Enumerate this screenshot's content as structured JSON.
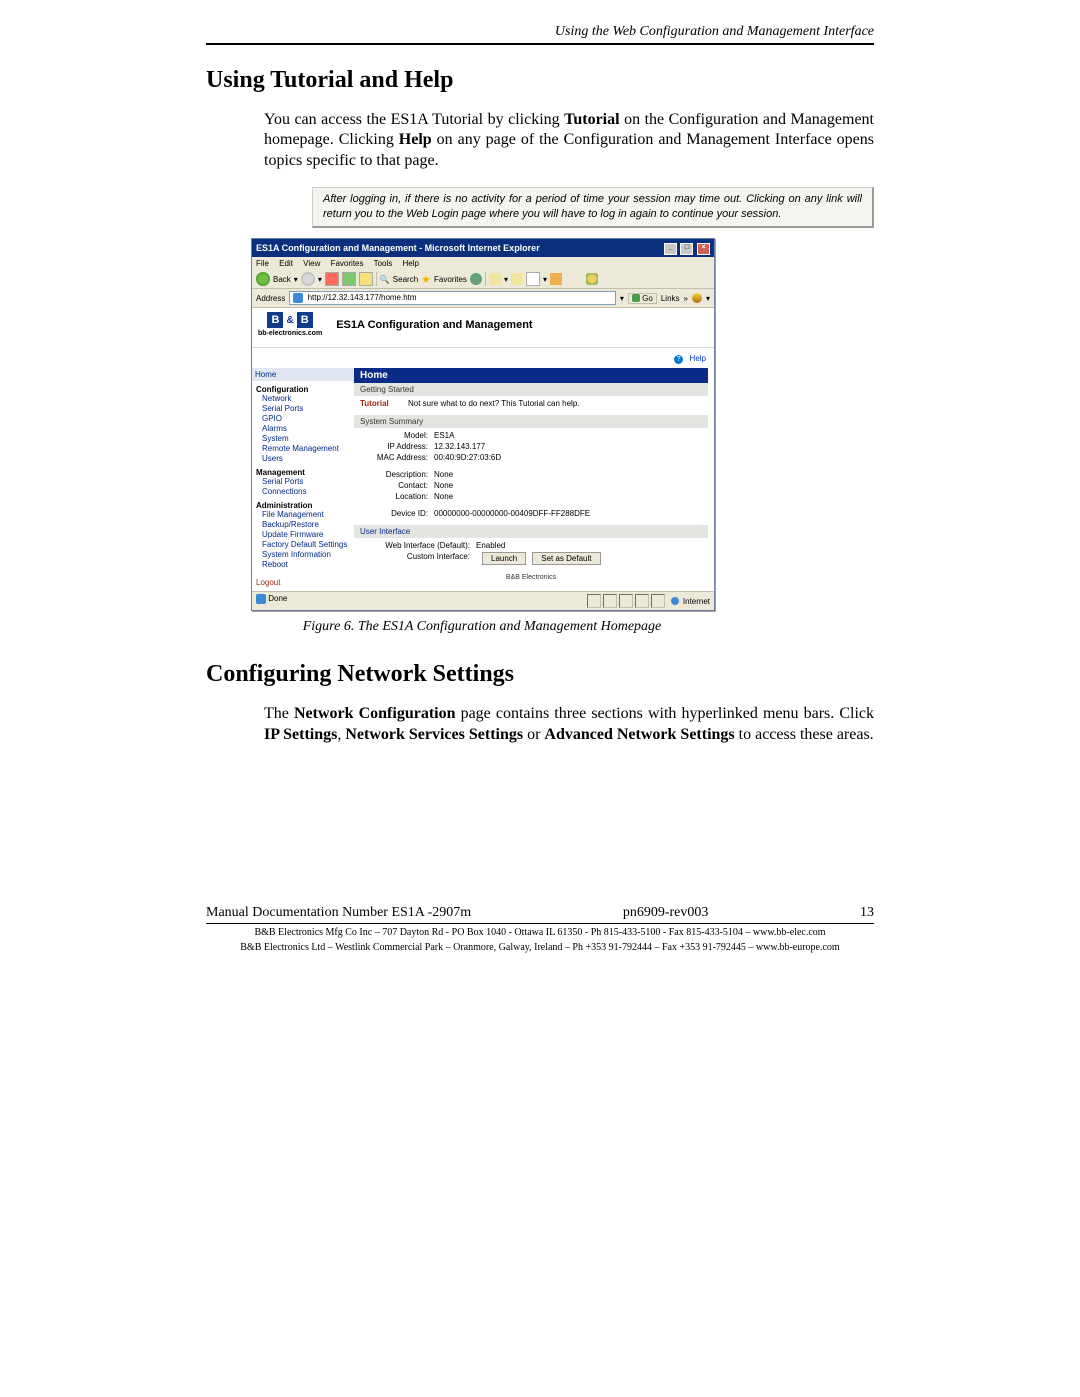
{
  "header_chapter": "Using the Web Configuration and Management Interface",
  "sec1_title": "Using Tutorial and Help",
  "sec1_para_pre": "You can access the ES1A Tutorial by clicking ",
  "sec1_para_b1": "Tutorial",
  "sec1_para_mid": " on the Configuration and Management homepage. Clicking ",
  "sec1_para_b2": "Help",
  "sec1_para_post": " on any page of the Configuration and Management Interface opens topics specific to that page.",
  "note_text": "After logging in, if there is no activity for a period of time your session may time out. Clicking on any link will return you to the Web Login page where you will have to log in again to continue your session.",
  "fig_caption": "Figure 6.    The ES1A Configuration and Management Homepage",
  "sec2_title": "Configuring Network Settings",
  "sec2_pre": "The ",
  "sec2_b1": "Network Configuration",
  "sec2_mid1": " page contains three sections with hyperlinked menu bars. Click ",
  "sec2_b2": "IP Settings",
  "sec2_mid2": ", ",
  "sec2_b3": "Network Services Settings",
  "sec2_mid3": " or ",
  "sec2_b4": "Advanced Network Settings",
  "sec2_post": " to access these areas.",
  "footer": {
    "doc_left": "Manual Documentation Number ES1A -2907m",
    "doc_mid": "pn6909-rev003",
    "doc_right": "13",
    "line2": "B&B Electronics Mfg Co Inc – 707 Dayton Rd - PO Box 1040 - Ottawa IL 61350 - Ph 815-433-5100 - Fax 815-433-5104 – www.bb-elec.com",
    "line3": "B&B Electronics Ltd – Westlink Commercial Park – Oranmore, Galway, Ireland – Ph +353 91-792444 – Fax +353 91-792445 – www.bb-europe.com"
  },
  "ie": {
    "title": "ES1A Configuration and Management - Microsoft Internet Explorer",
    "menu": {
      "file": "File",
      "edit": "Edit",
      "view": "View",
      "fav": "Favorites",
      "tools": "Tools",
      "help": "Help"
    },
    "back": "Back",
    "search": "Search",
    "favorites": "Favorites",
    "addr_label": "Address",
    "addr_value": "http://12.32.143.177/home.htm",
    "go": "Go",
    "links": "Links",
    "logo_sub": "bb-electronics.com",
    "header_title": "ES1A Configuration and Management",
    "help_link": "Help",
    "nav": {
      "home": "Home",
      "configuration": "Configuration",
      "network": "Network",
      "serial": "Serial Ports",
      "gpio": "GPIO",
      "alarms": "Alarms",
      "system": "System",
      "remote": "Remote Management",
      "users": "Users",
      "management": "Management",
      "mserial": "Serial Ports",
      "conn": "Connections",
      "admin": "Administration",
      "filemgmt": "File Management",
      "backup": "Backup/Restore",
      "update": "Update Firmware",
      "factory": "Factory Default Settings",
      "sysinfo": "System Information",
      "reboot": "Reboot",
      "logout": "Logout"
    },
    "panel": {
      "home": "Home",
      "getting_started": "Getting Started",
      "tutorial": "Tutorial",
      "tutorial_desc": "Not sure what to do next? This Tutorial can help.",
      "system_summary": "System Summary",
      "model_l": "Model:",
      "model_v": "ES1A",
      "ip_l": "IP Address:",
      "ip_v": "12.32.143.177",
      "mac_l": "MAC Address:",
      "mac_v": "00:40:9D:27:03:6D",
      "desc_l": "Description:",
      "desc_v": "None",
      "contact_l": "Contact:",
      "contact_v": "None",
      "loc_l": "Location:",
      "loc_v": "None",
      "devid_l": "Device ID:",
      "devid_v": "00000000-00000000-00409DFF-FF288DFE",
      "ui": "User Interface",
      "webdef_l": "Web Interface (Default):",
      "webdef_v": "Enabled",
      "custom_l": "Custom Interface:",
      "launch": "Launch",
      "setdef": "Set as Default",
      "bbe_footer": "B&B Electronics"
    },
    "status_done": "Done",
    "status_zone": "Internet"
  }
}
